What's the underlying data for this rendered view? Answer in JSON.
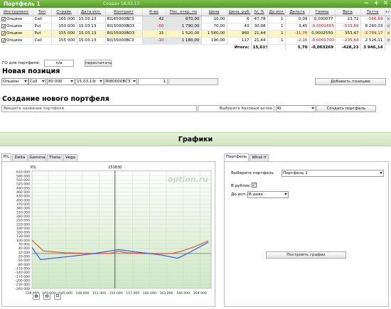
{
  "title": "Портфель 1",
  "created": "Создан 18.02.13",
  "window_buttons": {
    "minimize": "−",
    "maximize": "+",
    "close": "✕",
    "pin": "+/-"
  },
  "table": {
    "headers": [
      "Инструмент",
      "Тип",
      "Страйк",
      "Дата исп.",
      "Контракт",
      "К-во",
      "Пос. откр. по",
      "Цена",
      "Цена, руб.",
      "IV, %",
      "До исп.",
      "Дельта",
      "Гамма",
      "Вега",
      "Тетта"
    ],
    "rows": [
      {
        "instr": "Опцион",
        "type": "Call",
        "strike": "165 000",
        "date": "15.03.13",
        "contract": "RI165000BC3",
        "qty": "42",
        "open": "870,00",
        "price": "10,00",
        "rub": "6",
        "iv": "47,78",
        "days": "1",
        "delta": "0,09",
        "gamma": "0,000077",
        "vega": "23,72",
        "theta": "-566,69",
        "selected": false
      },
      {
        "instr": "Опцион",
        "type": "Put",
        "strike": "150 000",
        "date": "15.03.13",
        "contract": "RI150000BO3",
        "qty": "-50",
        "open": "1 790,00",
        "price": "70,00",
        "rub": "43",
        "iv": "30,98",
        "days": "1",
        "delta": "3,45",
        "gamma": "-0,0002665",
        "vega": "-533,89",
        "theta": "8 260,03",
        "selected": false
      },
      {
        "instr": "Опцион",
        "type": "Put",
        "strike": "155 000",
        "date": "15.03.13",
        "contract": "RI155000BO3",
        "qty": "15",
        "open": "1 520,00",
        "price": "1 560,00",
        "rub": "960",
        "iv": "21,44",
        "days": "1",
        "delta": "-11,76",
        "gamma": "0,0002550",
        "vega": "353,47",
        "theta": "-3 789,17",
        "selected": true
      },
      {
        "instr": "Опцион",
        "type": "Call",
        "strike": "155 000",
        "date": "15.03.13",
        "contract": "RI155000BC3",
        "qty": "-10",
        "open": "1 180,00",
        "price": "190,00",
        "rub": "117",
        "iv": "21,44",
        "days": "1",
        "delta": "-2,16",
        "gamma": "-0,0001700",
        "vega": "-235,64",
        "theta": "2 526,11",
        "selected": false
      }
    ],
    "total_label": "Итого:",
    "total_pct": "15,61%",
    "total_delta": "5,70",
    "total_gamma": "-0,003269",
    "total_vega": "-428,23",
    "total_theta": "3 946,14"
  },
  "go": {
    "label": "ГО для портфеля:",
    "value": "n/a",
    "recalc": "пересчитать"
  },
  "new_position": {
    "heading": "Новая позиция",
    "instr": "Опцион",
    "type": "Call",
    "strike": "80 000",
    "date": "15.03.13г",
    "contract": "RI80000BC3",
    "qty": "1",
    "add_button": "Добавить позицию"
  },
  "create": {
    "heading": "Создание нового портфеля",
    "name_placeholder": "Введите название портфеля",
    "base_label": "Выберите базовый актив",
    "base_value": "RI",
    "create_button": "Создать портфель"
  },
  "graphs": {
    "heading": "Графики",
    "tabs": [
      "P/L",
      "Delta",
      "Gamma",
      "Theta",
      "Vega"
    ],
    "right_tabs": [
      "Портфель",
      "What If"
    ]
  },
  "right_panel": {
    "portfolio_label": "Выберите портфель",
    "portfolio_value": "Портфель 1",
    "rub_label": "В рублях:",
    "days_label": "До исп.:",
    "days_value": "В днях",
    "build_button": "Построить график"
  },
  "chart_data": {
    "type": "line",
    "watermark": "option.ru",
    "series_label": "P/L",
    "marker_label": "153830",
    "marker_x": 153830,
    "xlim": [
      139000,
      171000
    ],
    "ylim": [
      -260,
      620
    ],
    "xticks": [
      "139 000",
      "142 000",
      "145 000",
      "148 000",
      "151 000",
      "154 000",
      "157 000",
      "160 000",
      "163 000",
      "166 000",
      "169 000"
    ],
    "yticks": [
      "610 000",
      "580 000",
      "550 000",
      "520 000",
      "490 000",
      "460 000",
      "430 000",
      "400 000",
      "370 000",
      "340 000",
      "310 000",
      "280 000",
      "250 000",
      "220 000",
      "190 000",
      "160 000",
      "130 000",
      "100 000",
      "70 000",
      "40 000",
      "10 000",
      "-20 000",
      "-50 000",
      "-80 000",
      "-110 000",
      "-140 000",
      "-170 000",
      "-200 000",
      "-230 000",
      "-260 000"
    ],
    "series": [
      {
        "color": "#e0572a",
        "points": [
          [
            139000,
            100
          ],
          [
            141000,
            20
          ],
          [
            145000,
            5
          ],
          [
            150000,
            0
          ],
          [
            153000,
            2
          ],
          [
            154500,
            18
          ],
          [
            156000,
            5
          ],
          [
            160000,
            0
          ],
          [
            162000,
            0
          ],
          [
            164000,
            0
          ],
          [
            166000,
            22
          ],
          [
            168000,
            50
          ],
          [
            170500,
            95
          ]
        ]
      },
      {
        "color": "#3355ee",
        "points": [
          [
            139000,
            45
          ],
          [
            140500,
            -45
          ],
          [
            145000,
            -25
          ],
          [
            150000,
            0
          ],
          [
            154500,
            30
          ],
          [
            158000,
            10
          ],
          [
            162000,
            -10
          ],
          [
            165000,
            -35
          ],
          [
            167000,
            5
          ],
          [
            170500,
            85
          ]
        ]
      }
    ]
  },
  "zoom_icons": [
    "zoom-in-icon",
    "zoom-out-icon",
    "zoom-fit-icon"
  ]
}
